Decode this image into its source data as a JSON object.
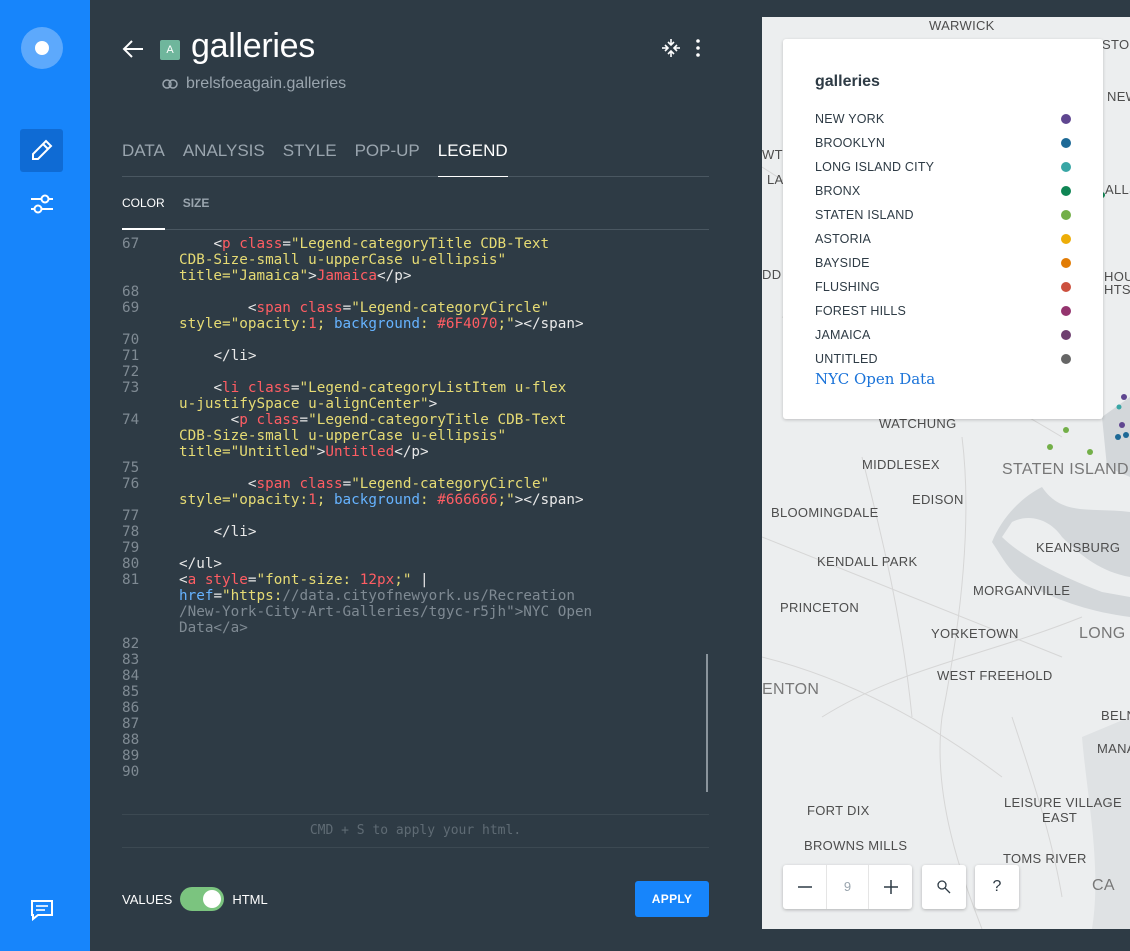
{
  "layer": {
    "badge": "A",
    "title": "galleries",
    "source": "brelsfoeagain.galleries"
  },
  "tabs": [
    "DATA",
    "ANALYSIS",
    "STYLE",
    "POP-UP",
    "LEGEND"
  ],
  "active_tab": "LEGEND",
  "subtabs": [
    "COLOR",
    "SIZE"
  ],
  "active_subtab": "COLOR",
  "code_lines": [
    {
      "n": "67",
      "html": "<span class=\"t-tag\">    &lt;</span><span class=\"t-name\">p</span> <span class=\"t-attr\">class</span>=<span class=\"t-str\">\"Legend-categoryTitle CDB-Text</span>"
    },
    {
      "n": "",
      "html": "<span class=\"t-str\">CDB-Size-small u-upperCase u-ellipsis\"</span>"
    },
    {
      "n": "",
      "html": "<span class=\"t-str\">title=\"Jamaica\"</span>&gt;<span class=\"t-name\">Jamaica</span>&lt;/p&gt;"
    },
    {
      "n": "68",
      "html": ""
    },
    {
      "n": "69",
      "html": "        &lt;<span class=\"t-name\">span</span> <span class=\"t-attr\">class</span>=<span class=\"t-str\">\"Legend-categoryCircle\"</span>"
    },
    {
      "n": "",
      "html": "<span class=\"t-str\">style=\"opacity:</span><span class=\"t-num\">1</span><span class=\"t-str\">; </span><span class=\"t-css\">background</span><span class=\"t-str\">: </span><span class=\"t-num\">#6F4070</span><span class=\"t-str\">;\"</span>&gt;&lt;/span&gt;"
    },
    {
      "n": "70",
      "html": ""
    },
    {
      "n": "71",
      "html": "    &lt;/li&gt;"
    },
    {
      "n": "72",
      "html": ""
    },
    {
      "n": "73",
      "html": "    &lt;<span class=\"t-name\">li</span> <span class=\"t-attr\">class</span>=<span class=\"t-str\">\"Legend-categoryListItem u-flex</span>"
    },
    {
      "n": "",
      "html": "<span class=\"t-str\">u-justifySpace u-alignCenter\"</span>&gt;"
    },
    {
      "n": "74",
      "html": "      &lt;<span class=\"t-name\">p</span> <span class=\"t-attr\">class</span>=<span class=\"t-str\">\"Legend-categoryTitle CDB-Text</span>"
    },
    {
      "n": "",
      "html": "<span class=\"t-str\">CDB-Size-small u-upperCase u-ellipsis\"</span>"
    },
    {
      "n": "",
      "html": "<span class=\"t-str\">title=\"Untitled\"</span>&gt;<span class=\"t-name\">Untitled</span>&lt;/p&gt;"
    },
    {
      "n": "75",
      "html": ""
    },
    {
      "n": "76",
      "html": "        &lt;<span class=\"t-name\">span</span> <span class=\"t-attr\">class</span>=<span class=\"t-str\">\"Legend-categoryCircle\"</span>"
    },
    {
      "n": "",
      "html": "<span class=\"t-str\">style=\"opacity:</span><span class=\"t-num\">1</span><span class=\"t-str\">; </span><span class=\"t-css\">background</span><span class=\"t-str\">: </span><span class=\"t-num\">#666666</span><span class=\"t-str\">;\"</span>&gt;&lt;/span&gt;"
    },
    {
      "n": "77",
      "html": ""
    },
    {
      "n": "78",
      "html": "    &lt;/li&gt;"
    },
    {
      "n": "79",
      "html": ""
    },
    {
      "n": "80",
      "html": "&lt;/ul&gt;"
    },
    {
      "n": "81",
      "html": "&lt;<span class=\"t-name\">a</span> <span class=\"t-attr\">style</span>=<span class=\"t-str\">\"font-size: </span><span class=\"t-num\">12px</span><span class=\"t-str\">;\"</span> |"
    },
    {
      "n": "",
      "html": "<span class=\"t-css\">href</span>=<span class=\"t-str\">\"https:</span><span class=\"t-gray\">//data.cityofnewyork.us/Recreation</span>"
    },
    {
      "n": "",
      "html": "<span class=\"t-gray\">/New-York-City-Art-Galleries/tgyc-r5jh\"&gt;NYC Open</span>"
    },
    {
      "n": "",
      "html": "<span class=\"t-gray\">Data&lt;/a&gt;</span>"
    },
    {
      "n": "82",
      "html": ""
    },
    {
      "n": "83",
      "html": ""
    },
    {
      "n": "84",
      "html": ""
    },
    {
      "n": "85",
      "html": ""
    },
    {
      "n": "86",
      "html": ""
    },
    {
      "n": "87",
      "html": ""
    },
    {
      "n": "88",
      "html": ""
    },
    {
      "n": "89",
      "html": ""
    },
    {
      "n": "90",
      "html": ""
    }
  ],
  "hint": "CMD + S to apply your html.",
  "toggle": {
    "left": "VALUES",
    "right": "HTML"
  },
  "apply_label": "APPLY",
  "legend": {
    "title": "galleries",
    "items": [
      {
        "label": "NEW YORK",
        "color": "#5f4690"
      },
      {
        "label": "BROOKLYN",
        "color": "#1d6996"
      },
      {
        "label": "LONG ISLAND CITY",
        "color": "#38a6a5"
      },
      {
        "label": "BRONX",
        "color": "#0f8554"
      },
      {
        "label": "STATEN ISLAND",
        "color": "#73af48"
      },
      {
        "label": "ASTORIA",
        "color": "#edad08"
      },
      {
        "label": "BAYSIDE",
        "color": "#e17c05"
      },
      {
        "label": "FLUSHING",
        "color": "#cc503e"
      },
      {
        "label": "FOREST HILLS",
        "color": "#94346e"
      },
      {
        "label": "JAMAICA",
        "color": "#6f4070"
      },
      {
        "label": "UNTITLED",
        "color": "#666666"
      }
    ],
    "link": "NYC Open Data"
  },
  "map": {
    "zoom_level": "9",
    "places": [
      {
        "name": "WARWICK",
        "cls": ""
      },
      {
        "name": "STON",
        "cls": ""
      },
      {
        "name": "NEW",
        "cls": ""
      },
      {
        "name": "WTO",
        "cls": ""
      },
      {
        "name": "LA",
        "cls": ""
      },
      {
        "name": "ALLSD",
        "cls": ""
      },
      {
        "name": "DD",
        "cls": ""
      },
      {
        "name": "HOUC",
        "cls": ""
      },
      {
        "name": "HTS",
        "cls": ""
      },
      {
        "name": "WATCHUNG",
        "cls": ""
      },
      {
        "name": "MIDDLESEX",
        "cls": ""
      },
      {
        "name": "STATEN ISLAND",
        "cls": "big"
      },
      {
        "name": "EDISON",
        "cls": ""
      },
      {
        "name": "BLOOMINGDALE",
        "cls": ""
      },
      {
        "name": "KEANSBURG",
        "cls": ""
      },
      {
        "name": "KENDALL PARK",
        "cls": ""
      },
      {
        "name": "MORGANVILLE",
        "cls": ""
      },
      {
        "name": "PRINCETON",
        "cls": ""
      },
      {
        "name": "YORKETOWN",
        "cls": ""
      },
      {
        "name": "LONG",
        "cls": "big"
      },
      {
        "name": "WEST FREEHOLD",
        "cls": ""
      },
      {
        "name": "ENTON",
        "cls": "big"
      },
      {
        "name": "BELN",
        "cls": ""
      },
      {
        "name": "MANASQ",
        "cls": ""
      },
      {
        "name": "LEISURE VILLAGE",
        "cls": ""
      },
      {
        "name": "EAST",
        "cls": ""
      },
      {
        "name": "FORT DIX",
        "cls": ""
      },
      {
        "name": "BROWNS MILLS",
        "cls": ""
      },
      {
        "name": "TOMS RIVER",
        "cls": ""
      },
      {
        "name": "CA",
        "cls": "big"
      }
    ]
  }
}
